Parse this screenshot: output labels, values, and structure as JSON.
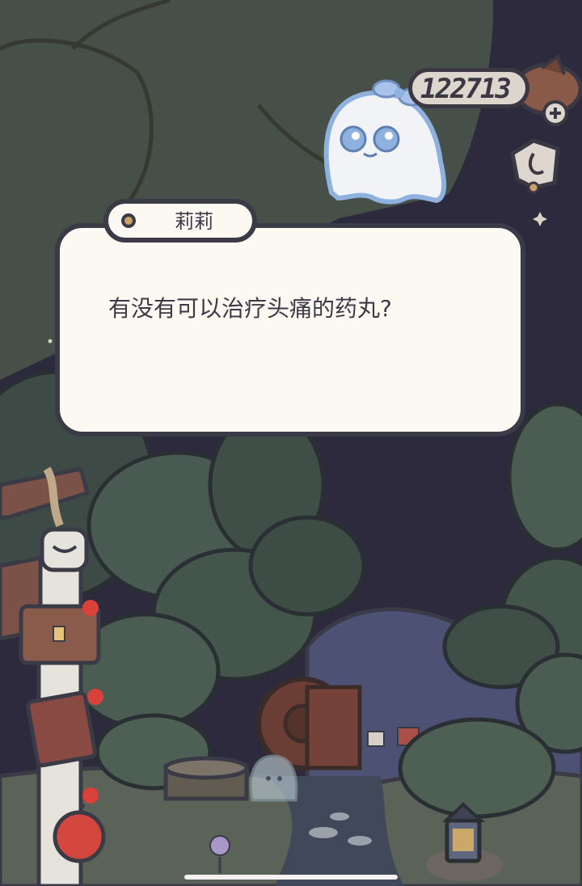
{
  "hud": {
    "coin_count": "122713",
    "coin_icon": "acorn-coin-icon",
    "add_icon": "plus-icon",
    "map_icon": "map-icon"
  },
  "dialogue": {
    "speaker_name": "莉莉",
    "text": "有没有可以治疗头痛的药丸?"
  },
  "colors": {
    "night_sky": "#2c2a3c",
    "foliage": "#4a5a50",
    "outline": "#3b3a47",
    "dialog_bg": "#fcf9f3",
    "ghost_blue": "#8fb1e0"
  }
}
